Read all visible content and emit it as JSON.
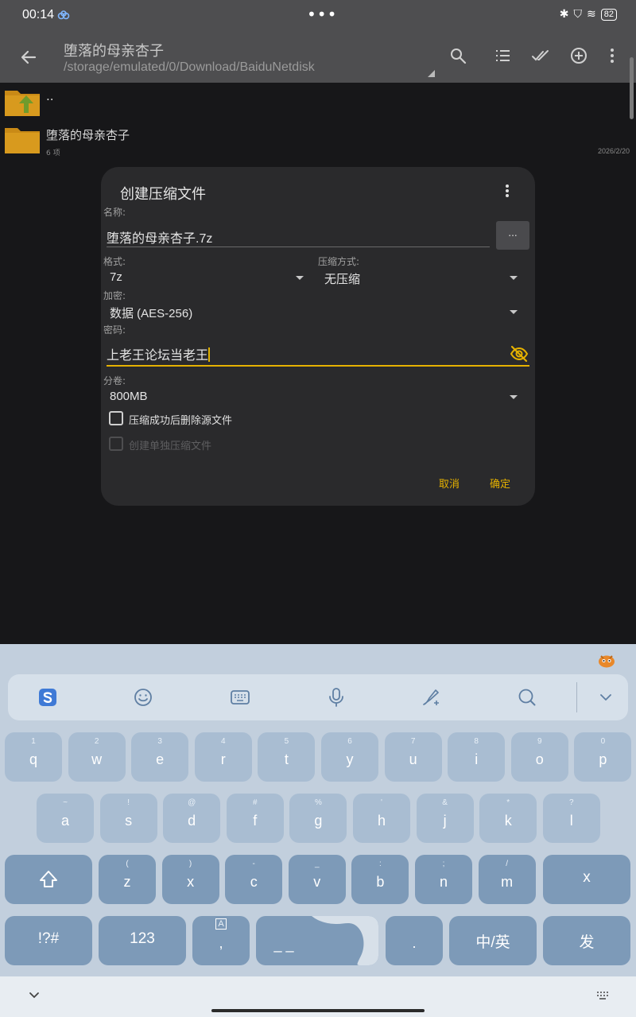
{
  "status_bar": {
    "time": "00:14",
    "battery": "82"
  },
  "app_bar": {
    "title": "堕落的母亲杏子",
    "path": "/storage/emulated/0/Download/BaiduNetdisk"
  },
  "files": [
    {
      "name": "..",
      "sub": "",
      "date": ""
    },
    {
      "name": "堕落的母亲杏子",
      "sub": "6 项",
      "date": "2026/2/20"
    }
  ],
  "dialog": {
    "title": "创建压缩文件",
    "name_label": "名称:",
    "name_value": "堕落的母亲杏子.7z",
    "browse_label": "...",
    "format_label": "格式:",
    "format_value": "7z",
    "method_label": "压缩方式:",
    "method_value": "无压缩",
    "encryption_label": "加密:",
    "encryption_value": "数据 (AES-256)",
    "password_label": "密码:",
    "password_value": "上老王论坛当老王",
    "volume_label": "分卷:",
    "volume_value": "800MB",
    "delete_source_label": "压缩成功后删除源文件",
    "single_archive_label": "创建单独压缩文件",
    "cancel_label": "取消",
    "ok_label": "确定"
  },
  "keyboard": {
    "row1": [
      {
        "hint": "1",
        "key": "q"
      },
      {
        "hint": "2",
        "key": "w"
      },
      {
        "hint": "3",
        "key": "e"
      },
      {
        "hint": "4",
        "key": "r"
      },
      {
        "hint": "5",
        "key": "t"
      },
      {
        "hint": "6",
        "key": "y"
      },
      {
        "hint": "7",
        "key": "u"
      },
      {
        "hint": "8",
        "key": "i"
      },
      {
        "hint": "9",
        "key": "o"
      },
      {
        "hint": "0",
        "key": "p"
      }
    ],
    "row2": [
      {
        "hint": "~",
        "key": "a"
      },
      {
        "hint": "!",
        "key": "s"
      },
      {
        "hint": "@",
        "key": "d"
      },
      {
        "hint": "#",
        "key": "f"
      },
      {
        "hint": "%",
        "key": "g"
      },
      {
        "hint": "'",
        "key": "h"
      },
      {
        "hint": "&",
        "key": "j"
      },
      {
        "hint": "*",
        "key": "k"
      },
      {
        "hint": "?",
        "key": "l"
      }
    ],
    "row3": [
      {
        "hint": "(",
        "key": "z"
      },
      {
        "hint": ")",
        "key": "x"
      },
      {
        "hint": "-",
        "key": "c"
      },
      {
        "hint": "_",
        "key": "v"
      },
      {
        "hint": ":",
        "key": "b"
      },
      {
        "hint": ";",
        "key": "n"
      },
      {
        "hint": "/",
        "key": "m"
      }
    ],
    "symbols_label": "!?#",
    "numbers_label": "123",
    "comma_hint": "A",
    "comma_label": ",",
    "space_label": "_ _",
    "period_label": ".",
    "lang_label": "中/英",
    "send_label": "发",
    "delete_label": "x"
  },
  "colors": {
    "accent": "#E5B100",
    "keyboard_bg": "#C2CFDD",
    "key_light": "#A9BDD2",
    "key_dark": "#7D9AB8"
  }
}
